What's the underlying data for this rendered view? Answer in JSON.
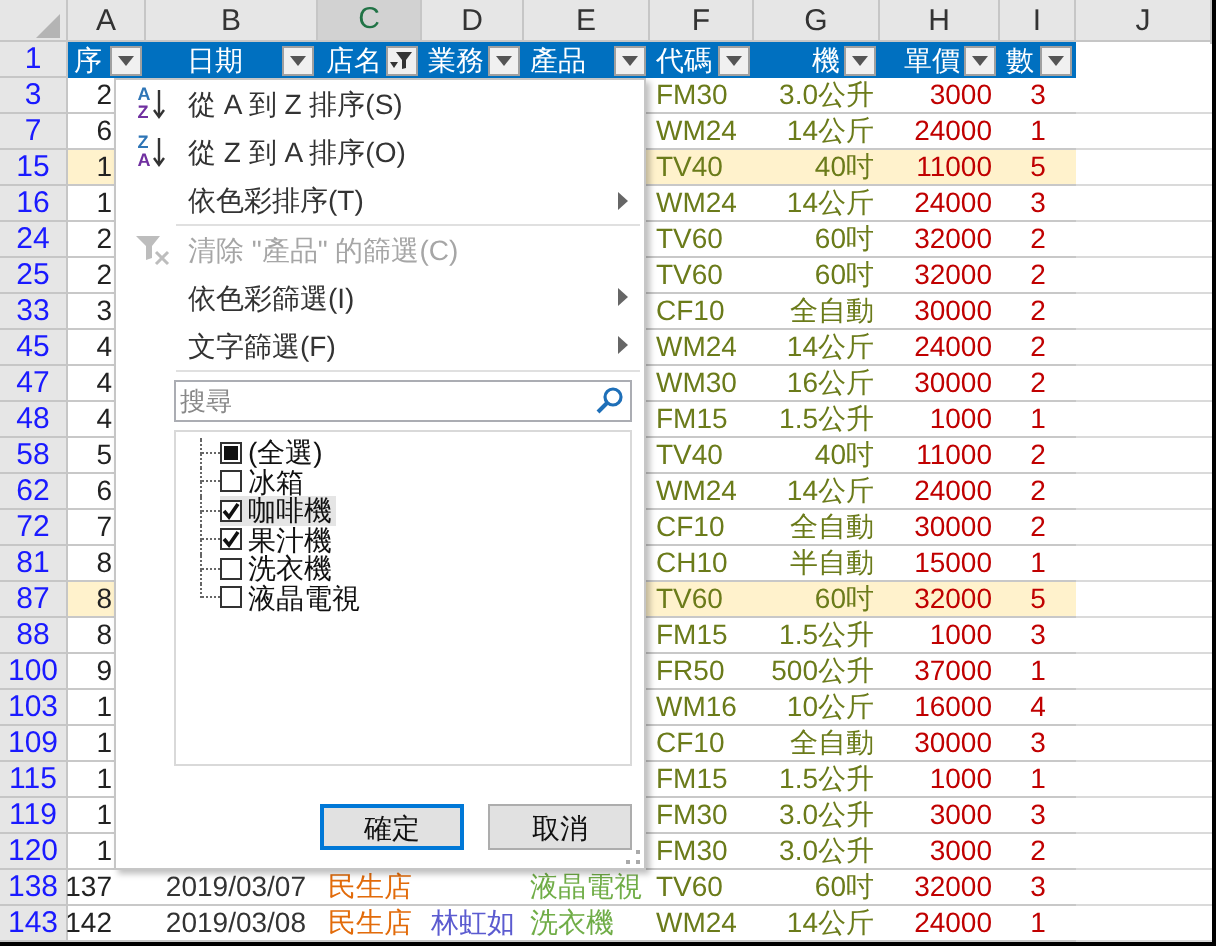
{
  "column_headers": [
    {
      "label": "A",
      "selected": false
    },
    {
      "label": "B",
      "selected": false
    },
    {
      "label": "C",
      "selected": true
    },
    {
      "label": "D",
      "selected": false
    },
    {
      "label": "E",
      "selected": false
    },
    {
      "label": "F",
      "selected": false
    },
    {
      "label": "G",
      "selected": false
    },
    {
      "label": "H",
      "selected": false
    },
    {
      "label": "I",
      "selected": false
    },
    {
      "label": "J",
      "selected": false
    }
  ],
  "header_row": {
    "row_number": "1",
    "cells": [
      {
        "label": "序",
        "filtered": false
      },
      {
        "label": "日期",
        "filtered": false
      },
      {
        "label": "店名",
        "filtered": true
      },
      {
        "label": "業務",
        "filtered": false
      },
      {
        "label": "產品",
        "filtered": false
      },
      {
        "label": "代碼",
        "filtered": false
      },
      {
        "label": "機",
        "filtered": false
      },
      {
        "label": "單價",
        "filtered": false
      },
      {
        "label": "數",
        "filtered": false
      }
    ]
  },
  "rows": [
    {
      "row_number": "3",
      "highlighted": false,
      "A": "2",
      "F": "FM30",
      "G": "3.0公升",
      "H": "3000",
      "I": "3"
    },
    {
      "row_number": "7",
      "highlighted": false,
      "A": "6",
      "F": "WM24",
      "G": "14公斤",
      "H": "24000",
      "I": "1"
    },
    {
      "row_number": "15",
      "highlighted": true,
      "A": "1",
      "F": "TV40",
      "G": "40吋",
      "H": "11000",
      "I": "5"
    },
    {
      "row_number": "16",
      "highlighted": false,
      "A": "1",
      "F": "WM24",
      "G": "14公斤",
      "H": "24000",
      "I": "3"
    },
    {
      "row_number": "24",
      "highlighted": false,
      "A": "2",
      "F": "TV60",
      "G": "60吋",
      "H": "32000",
      "I": "2"
    },
    {
      "row_number": "25",
      "highlighted": false,
      "A": "2",
      "F": "TV60",
      "G": "60吋",
      "H": "32000",
      "I": "2"
    },
    {
      "row_number": "33",
      "highlighted": false,
      "A": "3",
      "F": "CF10",
      "G": "全自動",
      "H": "30000",
      "I": "2"
    },
    {
      "row_number": "45",
      "highlighted": false,
      "A": "4",
      "F": "WM24",
      "G": "14公斤",
      "H": "24000",
      "I": "2"
    },
    {
      "row_number": "47",
      "highlighted": false,
      "A": "4",
      "F": "WM30",
      "G": "16公斤",
      "H": "30000",
      "I": "2"
    },
    {
      "row_number": "48",
      "highlighted": false,
      "A": "4",
      "F": "FM15",
      "G": "1.5公升",
      "H": "1000",
      "I": "1"
    },
    {
      "row_number": "58",
      "highlighted": false,
      "A": "5",
      "F": "TV40",
      "G": "40吋",
      "H": "11000",
      "I": "2"
    },
    {
      "row_number": "62",
      "highlighted": false,
      "A": "6",
      "F": "WM24",
      "G": "14公斤",
      "H": "24000",
      "I": "2"
    },
    {
      "row_number": "72",
      "highlighted": false,
      "A": "7",
      "F": "CF10",
      "G": "全自動",
      "H": "30000",
      "I": "2"
    },
    {
      "row_number": "81",
      "highlighted": false,
      "A": "8",
      "F": "CH10",
      "G": "半自動",
      "H": "15000",
      "I": "1"
    },
    {
      "row_number": "87",
      "highlighted": true,
      "A": "8",
      "F": "TV60",
      "G": "60吋",
      "H": "32000",
      "I": "5"
    },
    {
      "row_number": "88",
      "highlighted": false,
      "A": "8",
      "F": "FM15",
      "G": "1.5公升",
      "H": "1000",
      "I": "3"
    },
    {
      "row_number": "100",
      "highlighted": false,
      "A": "9",
      "F": "FR50",
      "G": "500公升",
      "H": "37000",
      "I": "1"
    },
    {
      "row_number": "103",
      "highlighted": false,
      "A": "1",
      "F": "WM16",
      "G": "10公斤",
      "H": "16000",
      "I": "4"
    },
    {
      "row_number": "109",
      "highlighted": false,
      "A": "1",
      "F": "CF10",
      "G": "全自動",
      "H": "30000",
      "I": "3"
    },
    {
      "row_number": "115",
      "highlighted": false,
      "A": "1",
      "F": "FM15",
      "G": "1.5公升",
      "H": "1000",
      "I": "1"
    },
    {
      "row_number": "119",
      "highlighted": false,
      "A": "1",
      "F": "FM30",
      "G": "3.0公升",
      "H": "3000",
      "I": "3"
    },
    {
      "row_number": "120",
      "highlighted": false,
      "A": "1",
      "F": "FM30",
      "G": "3.0公升",
      "H": "3000",
      "I": "2"
    },
    {
      "row_number": "138",
      "highlighted": false,
      "A": "137",
      "B": "2019/03/07",
      "C": "民生店",
      "E": "液晶電視",
      "F": "TV60",
      "G": "60吋",
      "H": "32000",
      "I": "3"
    },
    {
      "row_number": "143",
      "highlighted": false,
      "A": "142",
      "B": "2019/03/08",
      "C": "民生店",
      "D": "林虹如",
      "E": "洗衣機",
      "F": "WM24",
      "G": "14公斤",
      "H": "24000",
      "I": "1"
    }
  ],
  "filter_menu": {
    "items": [
      {
        "kind": "sort",
        "label": "從 A 到 Z 排序(S)",
        "icon_top": "A",
        "icon_bottom": "Z",
        "disabled": false,
        "submenu": false
      },
      {
        "kind": "sort",
        "label": "從 Z 到 A 排序(O)",
        "icon_top": "Z",
        "icon_bottom": "A",
        "disabled": false,
        "submenu": false
      },
      {
        "kind": "plain",
        "label": "依色彩排序(T)",
        "disabled": false,
        "submenu": true
      },
      {
        "kind": "separator"
      },
      {
        "kind": "clear",
        "label": "清除 \"產品\" 的篩選(C)",
        "disabled": true,
        "submenu": false
      },
      {
        "kind": "plain",
        "label": "依色彩篩選(I)",
        "disabled": false,
        "submenu": true
      },
      {
        "kind": "plain",
        "label": "文字篩選(F)",
        "disabled": false,
        "submenu": true
      },
      {
        "kind": "separator"
      }
    ],
    "search": {
      "placeholder": "搜尋"
    },
    "values": [
      {
        "label": "(全選)",
        "checked": false,
        "indeterminate": true,
        "selected": false
      },
      {
        "label": "冰箱",
        "checked": false,
        "indeterminate": false,
        "selected": false
      },
      {
        "label": "咖啡機",
        "checked": true,
        "indeterminate": false,
        "selected": true
      },
      {
        "label": "果汁機",
        "checked": true,
        "indeterminate": false,
        "selected": false
      },
      {
        "label": "洗衣機",
        "checked": false,
        "indeterminate": false,
        "selected": false
      },
      {
        "label": "液晶電視",
        "checked": false,
        "indeterminate": false,
        "selected": false
      }
    ],
    "buttons": [
      {
        "label": "確定",
        "default": true
      },
      {
        "label": "取消",
        "default": false
      }
    ]
  }
}
